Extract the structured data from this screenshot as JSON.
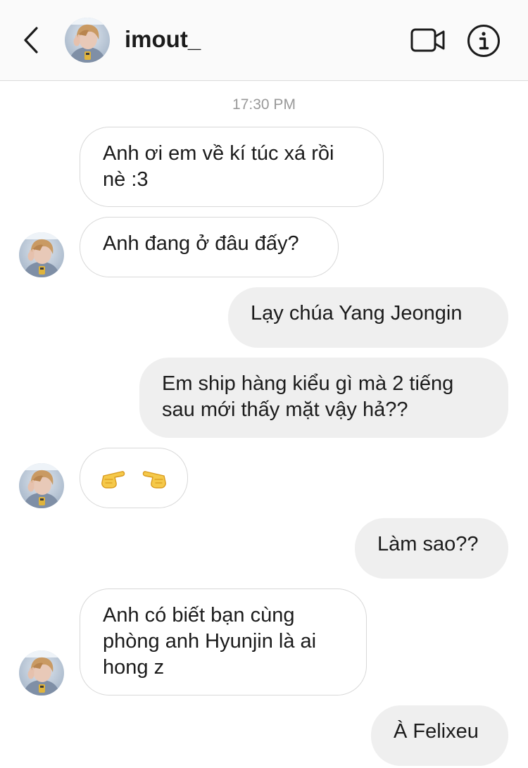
{
  "header": {
    "username": "imout_",
    "back_icon": "chevron-left-icon",
    "video_icon": "video-camera-icon",
    "info_icon": "info-icon"
  },
  "conversation": {
    "timestamp": "17:30 PM",
    "messages": [
      {
        "from": "them",
        "lines": [
          "Anh ơi em về kí túc xá rồi",
          "nè :3"
        ]
      },
      {
        "from": "them",
        "lines": [
          "Anh đang ở đâu đấy?"
        ]
      },
      {
        "from": "me",
        "lines": [
          "Lạy chúa Yang Jeongin"
        ]
      },
      {
        "from": "me",
        "lines": [
          "Em ship hàng kiểu gì mà 2 tiếng",
          "sau mới thấy mặt vậy hả??"
        ]
      },
      {
        "from": "them",
        "emoji": [
          "pointing-right-hand-emoji",
          "pointing-left-hand-emoji"
        ]
      },
      {
        "from": "me",
        "lines": [
          "Làm sao??"
        ]
      },
      {
        "from": "them",
        "lines": [
          "Anh có biết bạn cùng",
          "phòng anh Hyunjin là ai",
          "hong z"
        ]
      },
      {
        "from": "me",
        "lines": [
          "À Felixeu"
        ]
      }
    ]
  },
  "colors": {
    "header_bg": "#fafafa",
    "incoming_bubble_border": "#d8d8d8",
    "outgoing_bubble_bg": "#efefef",
    "timestamp": "#999999",
    "text": "#1b1b1b"
  }
}
